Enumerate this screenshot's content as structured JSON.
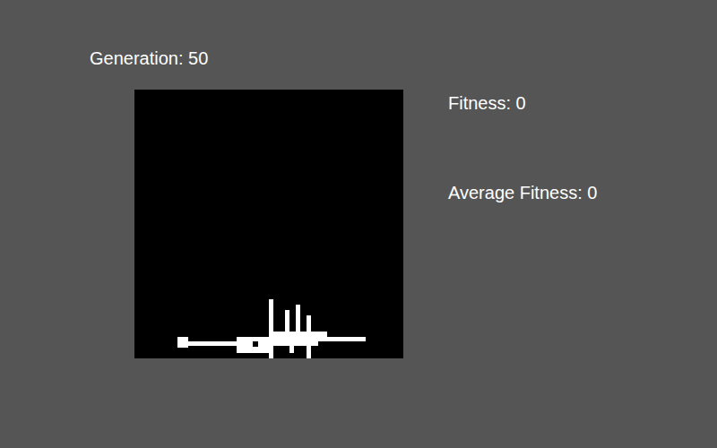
{
  "header": {
    "generation": "Generation: 50"
  },
  "stats": {
    "fitness": "Fitness: 0",
    "average_fitness": "Average Fitness: 0"
  }
}
